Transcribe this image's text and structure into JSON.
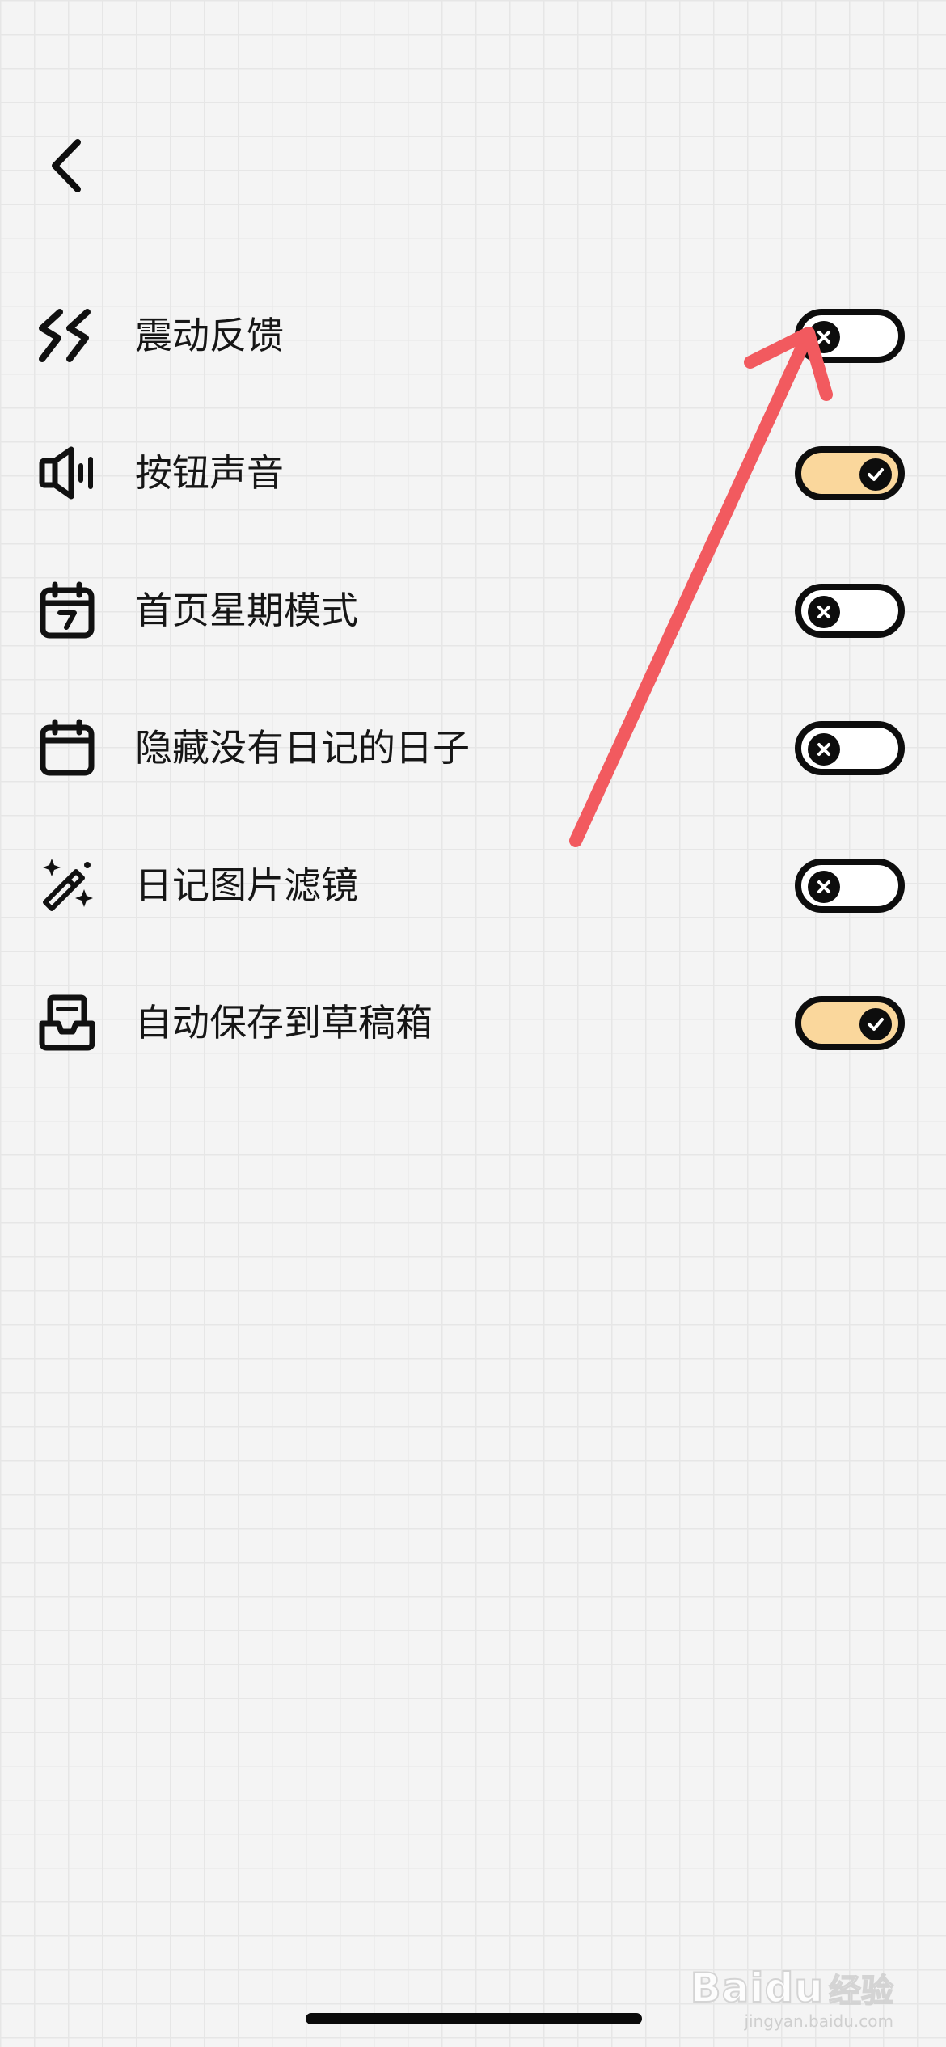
{
  "settings": [
    {
      "label": "震动反馈",
      "icon": "vibration-icon",
      "enabled": false
    },
    {
      "label": "按钮声音",
      "icon": "speaker-icon",
      "enabled": true
    },
    {
      "label": "首页星期模式",
      "icon": "calendar-week-icon",
      "enabled": false
    },
    {
      "label": "隐藏没有日记的日子",
      "icon": "calendar-icon",
      "enabled": false
    },
    {
      "label": "日记图片滤镜",
      "icon": "magic-wand-icon",
      "enabled": false
    },
    {
      "label": "自动保存到草稿箱",
      "icon": "inbox-drafts-icon",
      "enabled": true
    }
  ],
  "colors": {
    "toggle_on": "#fad79c",
    "toggle_off": "#ffffff",
    "annotation_arrow": "#f25a5f",
    "background": "#f4f4f4"
  },
  "watermark": {
    "brand": "Baidu",
    "suffix": "经验",
    "url": "jingyan.baidu.com"
  }
}
